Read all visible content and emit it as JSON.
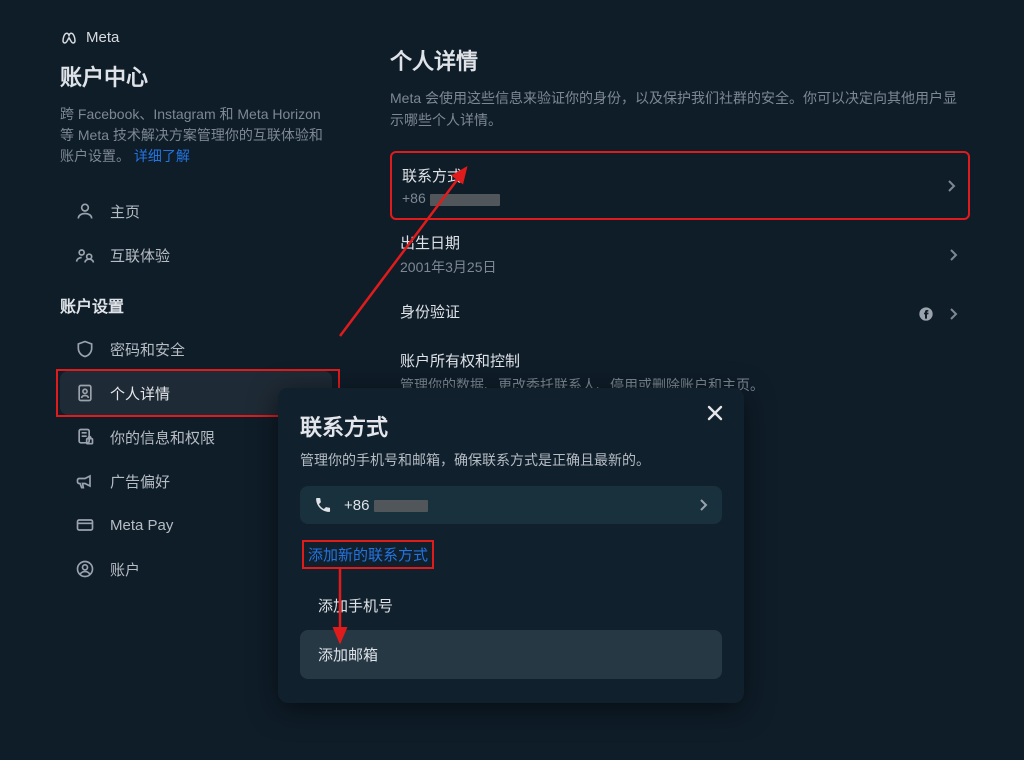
{
  "brand": "Meta",
  "sidebar": {
    "title": "账户中心",
    "description_pre": "跨 Facebook、Instagram 和 Meta Horizon 等 Meta 技术解决方案管理你的互联体验和账户设置。",
    "learn_more": "详细了解",
    "items_top": [
      {
        "label": "主页"
      },
      {
        "label": "互联体验"
      }
    ],
    "settings_header": "账户设置",
    "items_settings": [
      {
        "label": "密码和安全"
      },
      {
        "label": "个人详情"
      },
      {
        "label": "你的信息和权限"
      },
      {
        "label": "广告偏好"
      },
      {
        "label": "Meta Pay"
      },
      {
        "label": "账户"
      }
    ]
  },
  "main": {
    "title": "个人详情",
    "description": "Meta 会使用这些信息来验证你的身份，以及保护我们社群的安全。你可以决定向其他用户显示哪些个人详情。",
    "rows": {
      "contact": {
        "title": "联系方式",
        "sub_prefix": "+86"
      },
      "dob": {
        "title": "出生日期",
        "sub": "2001年3月25日"
      },
      "identity": {
        "title": "身份验证"
      },
      "ownership": {
        "title": "账户所有权和控制",
        "sub": "管理你的数据、更改委托联系人、停用或删除账户和主页。"
      }
    }
  },
  "modal": {
    "title": "联系方式",
    "subtitle": "管理你的手机号和邮箱，确保联系方式是正确且最新的。",
    "phone_prefix": "+86",
    "add_new": "添加新的联系方式",
    "option_phone": "添加手机号",
    "option_email": "添加邮箱"
  }
}
